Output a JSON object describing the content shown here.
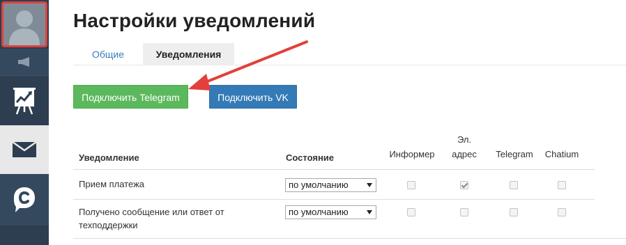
{
  "page": {
    "title": "Настройки уведомлений"
  },
  "tabs": [
    {
      "label": "Общие",
      "active": false
    },
    {
      "label": "Уведомления",
      "active": true
    }
  ],
  "buttons": {
    "telegram_label": "Подключить Telegram",
    "vk_label": "Подключить VK"
  },
  "table": {
    "headers": {
      "notification": "Уведомление",
      "state": "Состояние",
      "informer": "Информер",
      "email_line1": "Эл.",
      "email_line2": "адрес",
      "telegram": "Telegram",
      "chatium": "Chatium"
    },
    "rows": [
      {
        "name_line1": "Прием платежа",
        "name_line2": "",
        "state": "по умолчанию",
        "informer": false,
        "email": true,
        "telegram": false,
        "chatium": false
      },
      {
        "name_line1": "Получено сообщение или ответ от",
        "name_line2": "техподдержки",
        "state": "по умолчанию",
        "informer": false,
        "email": false,
        "telegram": false,
        "chatium": false
      }
    ]
  },
  "sidebar": {
    "icons": [
      "avatar-icon",
      "megaphone-icon",
      "chart-board-icon",
      "mail-icon",
      "chatium-logo-icon"
    ]
  },
  "colors": {
    "sidebar_bg": "#2c3e50",
    "highlight_red": "#e2403a",
    "telegram_btn": "#5cb85c",
    "vk_btn": "#337ab7",
    "tab_link": "#3a7bb8"
  }
}
